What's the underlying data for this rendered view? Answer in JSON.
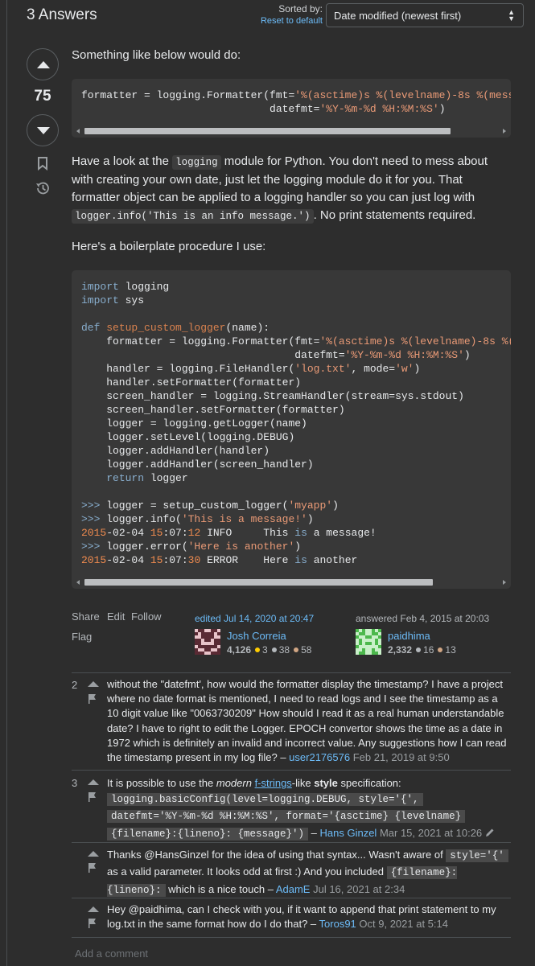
{
  "header": {
    "title": "3 Answers",
    "sorted_by_label": "Sorted by:",
    "reset_link": "Reset to default",
    "sort_selected": "Date modified (newest first)"
  },
  "answer": {
    "score": "75",
    "intro": "Something like below would do:",
    "para2_pre": "Have a look at the ",
    "para2_code": "logging",
    "para2_mid": " module for Python. You don't need to mess about with creating your own date, just let the logging module do it for you. That formatter object can be applied to a logging handler so you can just log with ",
    "para2_code2": "logger.info('This is an info message.')",
    "para2_post": ". No print statements required.",
    "para3": "Here's a boilerplate procedure I use:",
    "menu": {
      "share": "Share",
      "edit": "Edit",
      "follow": "Follow",
      "flag": "Flag"
    },
    "editor": {
      "action": "edited Jul 14, 2020 at 20:47",
      "name": "Josh Correia",
      "rep": "4,126",
      "gold": "3",
      "silver": "38",
      "bronze": "58"
    },
    "author": {
      "action": "answered Feb 4, 2015 at 20:03",
      "name": "paidhima",
      "rep": "2,332",
      "silver": "16",
      "bronze": "13"
    }
  },
  "comments": [
    {
      "score": "2",
      "text": "without the \"datefmt', how would the formatter display the timestamp? I have a project where no date format is mentioned, I need to read logs and I see the timestamp as a 10 digit value like \"0063730209\" How should I read it as a real human understandable date? I have to right to edit the Logger. EPOCH convertor shows the time as a date in 1972 which is definitely an invalid and incorrect value. Any suggestions how I can read the timestamp present in my log file? – ",
      "user": "user2176576",
      "date": "Feb 21, 2019 at 9:50"
    },
    {
      "score": "3",
      "t1": "It is possible to use the ",
      "t_em": "modern",
      "t_link": "f-strings",
      "t2": "-like ",
      "t_strong": "style",
      "t3": " specification:",
      "code_l1": "logging.basicConfig(level=logging.DEBUG, style='{',",
      "code_l2": "datefmt='%Y-%m-%d %H:%M:%S', format='{asctime} {levelname}",
      "code_l3": "{filename}:{lineno}: {message}')",
      "user": "Hans Ginzel",
      "date": "Mar 15, 2021 at 10:26"
    },
    {
      "t1": "Thanks @HansGinzel for the idea of using that syntax... Wasn't aware of ",
      "c1": "style='{'",
      "t2": " as a valid parameter. It looks odd at first :) And you included ",
      "c2": "{filename}:{lineno}:",
      "t3": " which is a nice touch – ",
      "user": "AdamE",
      "date": "Jul 16, 2021 at 2:34"
    },
    {
      "text": "Hey @paidhima, can I check with you, if it want to append that print statement to my log.txt in the same format how do I do that? – ",
      "user": "Toros91",
      "date": "Oct 9, 2021 at 5:14"
    }
  ],
  "add_comment": "Add a comment",
  "colors": {
    "link": "#6cbbf7",
    "background": "#2d2d2d",
    "code_bg": "#383838"
  }
}
